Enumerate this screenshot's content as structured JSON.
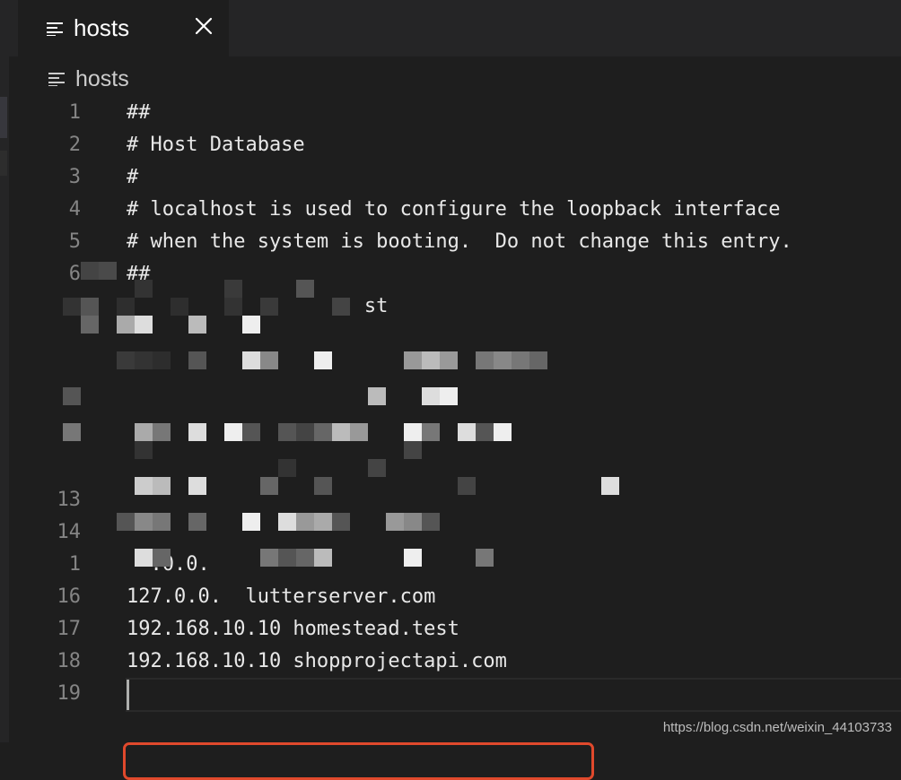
{
  "tab": {
    "title": "hosts",
    "icon": "file-lines-icon",
    "close_icon": "close-icon"
  },
  "breadcrumb": {
    "label": "hosts",
    "icon": "file-lines-icon"
  },
  "editor": {
    "line_numbers": [
      "1",
      "2",
      "3",
      "4",
      "5",
      "6",
      "",
      "",
      "",
      "",
      "",
      "",
      "13",
      "14",
      "1",
      "16",
      "17",
      "18",
      "19"
    ],
    "lines": [
      "##",
      "# Host Database",
      "#",
      "# localhost is used to configure the loopback interface",
      "# when the system is booting.  Do not change this entry.",
      "##",
      "                    st",
      "",
      "",
      "",
      "",
      "",
      "",
      "",
      "  .0.0.",
      "127.0.0.  lutterserver.com",
      "192.168.10.10 homestead.test",
      "192.168.10.10 shopprojectapi.com",
      ""
    ]
  },
  "colors": {
    "background": "#1e1e1e",
    "highlight": "#e0492c",
    "gutter_text": "#858585",
    "code_text": "#e8e8e8"
  },
  "watermark": "https://blog.csdn.net/weixin_44103733"
}
